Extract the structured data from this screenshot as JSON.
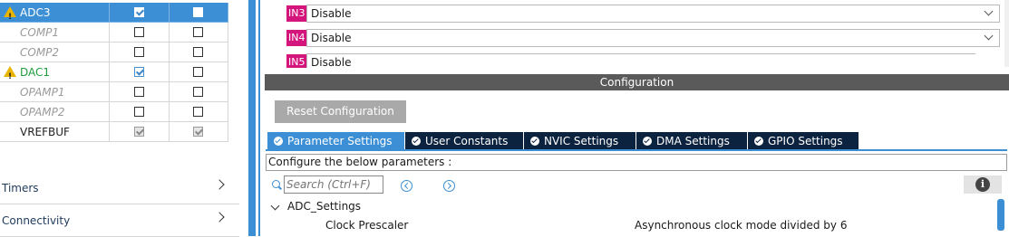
{
  "peripherals": [
    {
      "name": "ADC3",
      "warning": true,
      "state": "enabled",
      "selected": true,
      "col1": "checked",
      "col2": "unchecked"
    },
    {
      "name": "COMP1",
      "warning": false,
      "state": "disabled",
      "selected": false,
      "col1": "unchecked",
      "col2": "unchecked"
    },
    {
      "name": "COMP2",
      "warning": false,
      "state": "disabled",
      "selected": false,
      "col1": "unchecked",
      "col2": "unchecked"
    },
    {
      "name": "DAC1",
      "warning": true,
      "state": "enabled",
      "selected": false,
      "col1": "checked",
      "col2": "unchecked"
    },
    {
      "name": "OPAMP1",
      "warning": false,
      "state": "disabled",
      "selected": false,
      "col1": "unchecked",
      "col2": "unchecked"
    },
    {
      "name": "OPAMP2",
      "warning": false,
      "state": "disabled",
      "selected": false,
      "col1": "unchecked",
      "col2": "unchecked"
    },
    {
      "name": "VREFBUF",
      "warning": false,
      "state": "plain",
      "selected": false,
      "col1": "grey-checked",
      "col2": "grey-checked"
    }
  ],
  "categories": [
    {
      "label": "Timers",
      "icon": "chevron-right-icon"
    },
    {
      "label": "Connectivity",
      "icon": "chevron-right-icon"
    }
  ],
  "inputs": [
    {
      "badge": "IN3",
      "value": "Disable"
    },
    {
      "badge": "IN4",
      "value": "Disable"
    },
    {
      "badge": "IN5",
      "value": "Disable"
    }
  ],
  "configuration": {
    "title": "Configuration",
    "reset_label": "Reset Configuration",
    "tabs": [
      {
        "label": "Parameter Settings",
        "active": true
      },
      {
        "label": "User Constants",
        "active": false
      },
      {
        "label": "NVIC Settings",
        "active": false
      },
      {
        "label": "DMA Settings",
        "active": false
      },
      {
        "label": "GPIO Settings",
        "active": false
      }
    ],
    "description": "Configure the below parameters :",
    "search_placeholder": "Search (Ctrl+F)",
    "section_label": "ADC_Settings",
    "params": [
      {
        "name": "Clock Prescaler",
        "value": "Asynchronous clock mode divided by 6"
      }
    ]
  },
  "colors": {
    "accent": "#3c8fd4",
    "tab_dark": "#0c2340",
    "badge": "#d4157b",
    "header_bar": "#5a5a5a",
    "enabled_text": "#1f9c3a",
    "warning": "#e8b400"
  }
}
